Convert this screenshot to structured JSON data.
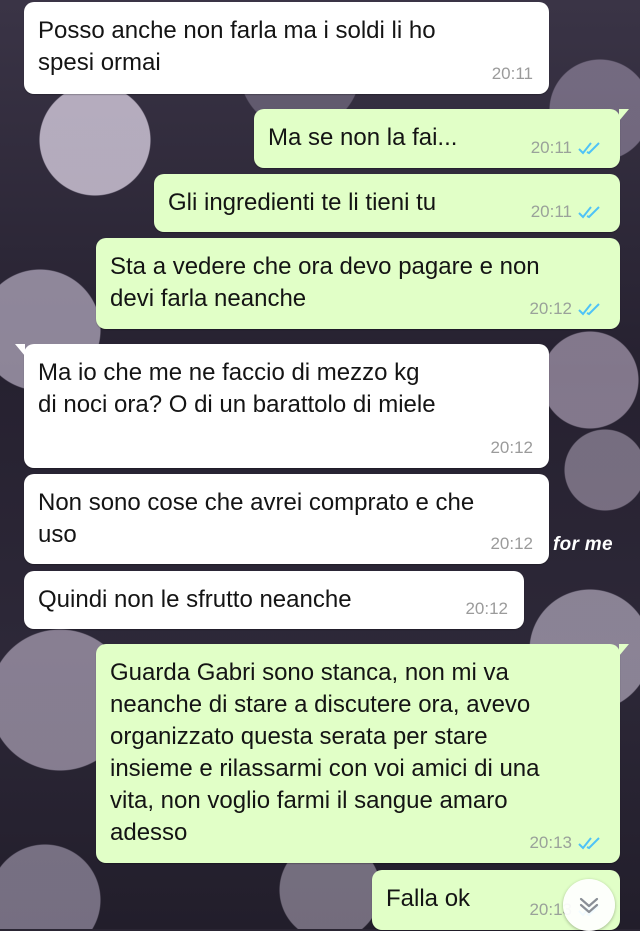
{
  "wallpaper": {
    "caption": "for me"
  },
  "messages": [
    {
      "dir": "in",
      "text": "Posso anche non farla ma i soldi li ho\nspesi ormai",
      "time": "20:11"
    },
    {
      "dir": "out",
      "text": "Ma se non la fai...",
      "time": "20:11",
      "status": "read"
    },
    {
      "dir": "out",
      "text": "Gli ingredienti te li tieni tu",
      "time": "20:11",
      "status": "read"
    },
    {
      "dir": "out",
      "text": "Sta a vedere che ora devo pagare e non\ndevi farla neanche",
      "time": "20:12",
      "status": "read"
    },
    {
      "dir": "in",
      "text": "Ma io che me ne faccio di mezzo kg\ndi noci ora? O di un barattolo di miele",
      "time": "20:12"
    },
    {
      "dir": "in",
      "text": "Non sono cose che avrei comprato e che\nuso",
      "time": "20:12"
    },
    {
      "dir": "in",
      "text": "Quindi non le sfrutto neanche",
      "time": "20:12"
    },
    {
      "dir": "out",
      "text": "Guarda Gabri sono stanca, non mi va\nneanche di stare a discutere ora, avevo\norganizzato questa serata per stare\ninsieme e rilassarmi con voi amici di una\nvita, non voglio farmi il sangue amaro\nadesso",
      "time": "20:13",
      "status": "read"
    },
    {
      "dir": "out",
      "text": "Falla ok",
      "time": "20:13",
      "status": "read"
    }
  ],
  "colors": {
    "incoming_bubble": "#ffffff",
    "outgoing_bubble": "#e1ffc7",
    "read_ticks": "#4fc3f7"
  },
  "scroll_button_icon": "chevron-down-icon"
}
